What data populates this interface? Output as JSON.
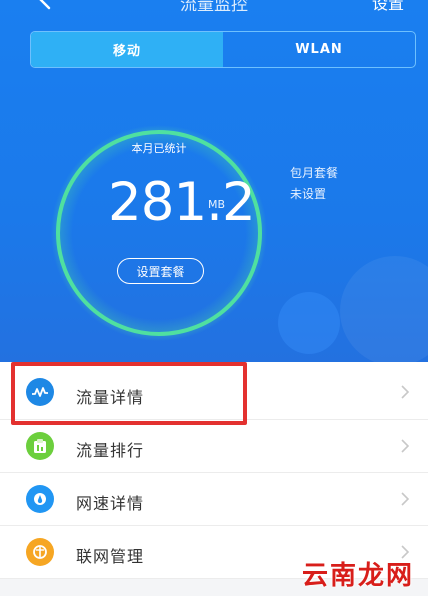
{
  "header": {
    "title": "流量监控",
    "settings_label": "设置"
  },
  "network_switch": {
    "tabs": [
      {
        "label": "移动",
        "active": true
      },
      {
        "label": "WLAN",
        "active": false
      }
    ]
  },
  "usage": {
    "caption": "本月已统计",
    "value": "281.2",
    "unit": "MB",
    "set_plan_label": "设置套餐"
  },
  "plan": {
    "line1": "包月套餐",
    "line2": "未设置"
  },
  "menu": {
    "items": [
      {
        "label": "流量详情",
        "icon": "wave-icon",
        "color": "#1e88e5"
      },
      {
        "label": "流量排行",
        "icon": "ranking-icon",
        "color": "#6ccf3d"
      },
      {
        "label": "网速详情",
        "icon": "speed-icon",
        "color": "#2196f3"
      },
      {
        "label": "联网管理",
        "icon": "network-manage-icon",
        "color": "#f6a623"
      }
    ]
  },
  "watermark": {
    "text": "云南龙网"
  },
  "colors": {
    "header_blue": "#1b79ea",
    "ring_green": "#4fe0a0",
    "highlight_red": "#e3312f"
  }
}
